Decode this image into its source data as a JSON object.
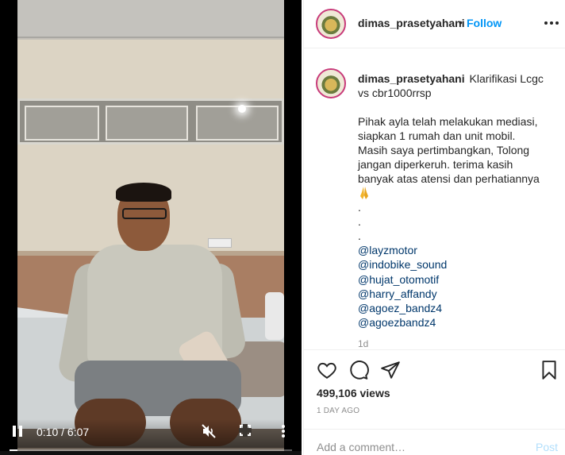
{
  "video": {
    "time": "0:10 / 6:07",
    "progress": 0.027
  },
  "header": {
    "username": "dimas_prasetyahani",
    "separator": "•",
    "follow_label": "Follow"
  },
  "caption": {
    "username": "dimas_prasetyahani",
    "title": "Klarifikasi Lcgc vs cbr1000rrsp",
    "lines": [
      "Pihak ayla telah melakukan mediasi,",
      "siapkan 1 rumah dan unit mobil.",
      "Masih saya pertimbangkan, Tolong",
      "jangan diperkeruh. terima kasih",
      "banyak atas atensi dan perhatiannya"
    ],
    "emoji": "🙏",
    "dots": [
      ".",
      ".",
      "."
    ],
    "mentions": [
      "@layzmotor",
      "@indobike_sound",
      "@hujat_otomotif",
      "@harry_affandy",
      "@agoez_bandz4",
      "@agoezbandz4"
    ],
    "time_ago": "1d"
  },
  "stats": {
    "views": "499,106 views",
    "date": "1 DAY AGO"
  },
  "comment": {
    "placeholder": "Add a comment…",
    "post_label": "Post"
  },
  "icons": {
    "like": "heart-icon",
    "comment": "comment-icon",
    "share": "share-icon",
    "save": "bookmark-icon"
  },
  "colors": {
    "accent": "#0095f6",
    "post_disabled": "#b2dffc",
    "muted": "#8e8e8e",
    "mention": "#00376b"
  }
}
